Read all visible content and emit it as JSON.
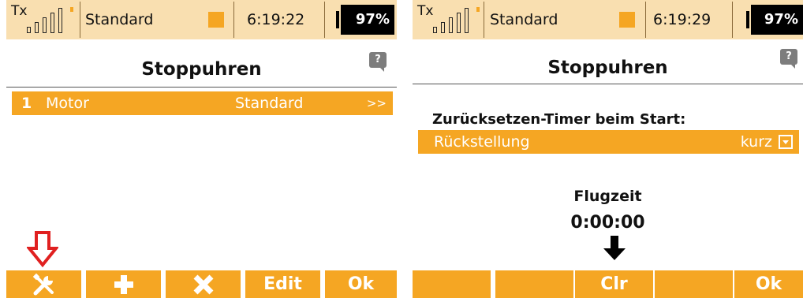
{
  "colors": {
    "accent": "#f5a623",
    "statusbar_bg": "#f9dfb0",
    "battery_bg": "#000000",
    "arrow_red": "#e02020"
  },
  "screen1": {
    "status": {
      "tx_label": "Tx",
      "model": "Standard",
      "time": "6:19:22",
      "battery": "97%"
    },
    "title": "Stoppuhren",
    "help_label": "?",
    "list": [
      {
        "index": "1",
        "name": "Motor",
        "value": "Standard",
        "chevron": ">>"
      }
    ],
    "buttons": [
      {
        "icon": "wrench-icon"
      },
      {
        "icon": "plus-icon"
      },
      {
        "icon": "x-icon"
      },
      {
        "label": "Edit"
      },
      {
        "label": "Ok"
      }
    ],
    "annotation_icon": "red-down-arrow-icon"
  },
  "screen2": {
    "status": {
      "tx_label": "Tx",
      "model": "Standard",
      "time": "6:19:29",
      "battery": "97%"
    },
    "title": "Stoppuhren",
    "help_label": "?",
    "section_heading": "Zurücksetzen-Timer beim Start:",
    "reset_row": {
      "label": "Rückstellung",
      "value": "kurz",
      "dropdown_icon": "dropdown-icon"
    },
    "flight_time": {
      "label": "Flugzeit",
      "value": "0:00:00"
    },
    "annotation_icon": "black-down-arrow-icon",
    "buttons": [
      {
        "label": ""
      },
      {
        "label": ""
      },
      {
        "label": "Clr"
      },
      {
        "label": ""
      },
      {
        "label": "Ok"
      }
    ]
  }
}
